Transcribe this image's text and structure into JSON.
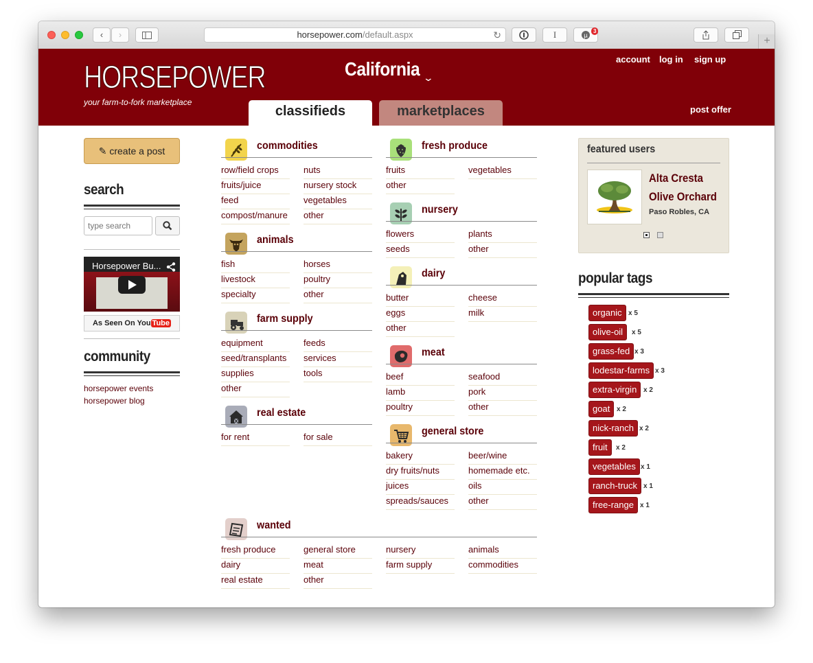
{
  "browser": {
    "url_host": "horsepower.com",
    "url_path": "/default.aspx",
    "extension_badge": "3"
  },
  "header": {
    "logo": "HORSEPOWER",
    "tagline": "your farm-to-fork marketplace",
    "state": "California",
    "links": {
      "account": "account",
      "login": "log in",
      "signup": "sign up",
      "post_offer": "post offer"
    },
    "tabs": {
      "classifieds": "classifieds",
      "marketplaces": "marketplaces"
    }
  },
  "sidebar": {
    "create_post": "create a post",
    "search_heading": "search",
    "search_placeholder": "type search",
    "video_title": "Horsepower Bu...",
    "youtube_prefix": "As Seen On",
    "youtube_you": "You",
    "youtube_tube": "Tube",
    "community_heading": "community",
    "community_links": [
      "horsepower events",
      "horsepower blog"
    ]
  },
  "categories": {
    "commodities": {
      "title": "commodities",
      "items": [
        "row/field crops",
        "nuts",
        "fruits/juice",
        "nursery stock",
        "feed",
        "vegetables",
        "compost/manure",
        "other"
      ]
    },
    "animals": {
      "title": "animals",
      "items": [
        "fish",
        "horses",
        "livestock",
        "poultry",
        "specialty",
        "other"
      ]
    },
    "farm_supply": {
      "title": "farm supply",
      "items": [
        "equipment",
        "feeds",
        "seed/transplants",
        "services",
        "supplies",
        "tools",
        "other"
      ]
    },
    "real_estate": {
      "title": "real estate",
      "items": [
        "for rent",
        "for sale"
      ]
    },
    "fresh_produce": {
      "title": "fresh produce",
      "items": [
        "fruits",
        "vegetables",
        "other"
      ]
    },
    "nursery": {
      "title": "nursery",
      "items": [
        "flowers",
        "plants",
        "seeds",
        "other"
      ]
    },
    "dairy": {
      "title": "dairy",
      "items": [
        "butter",
        "cheese",
        "eggs",
        "milk",
        "other"
      ]
    },
    "meat": {
      "title": "meat",
      "items": [
        "beef",
        "seafood",
        "lamb",
        "pork",
        "poultry",
        "other"
      ]
    },
    "general_store": {
      "title": "general store",
      "items": [
        "bakery",
        "beer/wine",
        "dry fruits/nuts",
        "homemade etc.",
        "juices",
        "oils",
        "spreads/sauces",
        "other"
      ]
    },
    "wanted": {
      "title": "wanted",
      "items": [
        "fresh produce",
        "general store",
        "nursery",
        "animals",
        "dairy",
        "meat",
        "farm supply",
        "commodities",
        "real estate",
        "other"
      ]
    }
  },
  "featured": {
    "heading": "featured users",
    "name_line1": "Alta Cresta",
    "name_line2": "Olive Orchard",
    "location": "Paso Robles, CA"
  },
  "tags": {
    "heading": "popular tags",
    "list": [
      {
        "name": "organic",
        "count": "x 5"
      },
      {
        "name": "olive-oil",
        "count": "x 5"
      },
      {
        "name": "grass-fed",
        "count": "x 3"
      },
      {
        "name": "lodestar-farms",
        "count": "x 3"
      },
      {
        "name": "extra-virgin",
        "count": "x 2"
      },
      {
        "name": "goat",
        "count": "x 2"
      },
      {
        "name": "nick-ranch",
        "count": "x 2"
      },
      {
        "name": "fruit",
        "count": "x 2"
      },
      {
        "name": "vegetables",
        "count": "x 1"
      },
      {
        "name": "ranch-truck",
        "count": "x 1"
      },
      {
        "name": "free-range",
        "count": "x 1"
      }
    ]
  },
  "colors": {
    "brand": "#800008",
    "link": "#5a0008",
    "tag": "#a5161b",
    "create_button": "#e8c07a"
  }
}
